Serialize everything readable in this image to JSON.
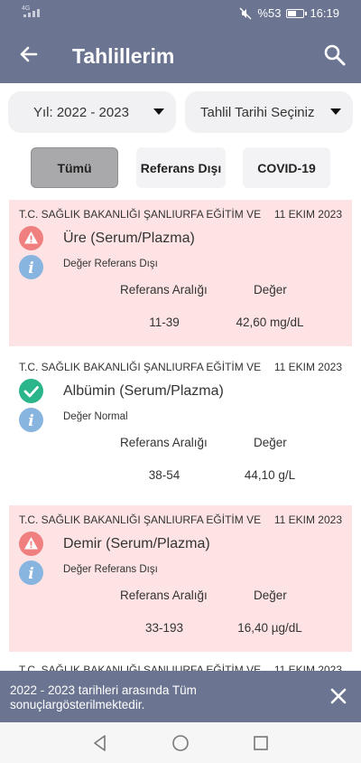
{
  "status_bar": {
    "network": "4G",
    "battery": "%53",
    "time": "16:19"
  },
  "header": {
    "title": "Tahlillerim"
  },
  "dropdowns": {
    "year": "Yıl: 2022 - 2023",
    "date": "Tahlil Tarihi Seçiniz"
  },
  "filters": [
    "Tümü",
    "Referans Dışı",
    "COVID-19"
  ],
  "results": [
    {
      "institution": "T.C. SAĞLIK BAKANLIĞI ŞANLIURFA EĞİTİM VE",
      "date": "11 EKIM 2023",
      "name": "Üre (Serum/Plazma)",
      "note": "Değer Referans Dışı",
      "range_header": "Referans Aralığı",
      "value_header": "Değer",
      "range": "11-39",
      "value": "42,60 mg/dL",
      "status": "out-of-range"
    },
    {
      "institution": "T.C. SAĞLIK BAKANLIĞI ŞANLIURFA EĞİTİM VE",
      "date": "11 EKIM 2023",
      "name": "Albümin (Serum/Plazma)",
      "note": "Değer Normal",
      "range_header": "Referans Aralığı",
      "value_header": "Değer",
      "range": "38-54",
      "value": "44,10 g/L",
      "status": "normal"
    },
    {
      "institution": "T.C. SAĞLIK BAKANLIĞI ŞANLIURFA EĞİTİM VE",
      "date": "11 EKIM 2023",
      "name": "Demir (Serum/Plazma)",
      "note": "Değer Referans Dışı",
      "range_header": "Referans Aralığı",
      "value_header": "Değer",
      "range": "33-193",
      "value": "16,40 µg/dL",
      "status": "out-of-range"
    },
    {
      "institution": "T.C. SAĞLIK BAKANLIĞI ŞANLIURFA EĞİTİM VE",
      "date": "11 EKIM 2023"
    }
  ],
  "snackbar": {
    "message": "2022 - 2023 tarihleri arasında Tüm sonuçlargösterilmektedir."
  },
  "icons": {
    "back": "arrow-left-icon",
    "search": "search-icon",
    "warning": "warning-icon",
    "check": "check-circle-icon",
    "info": "info-icon",
    "close": "close-icon"
  },
  "colors": {
    "appbar": "#6b7591",
    "out_of_range_bg": "#fde3e3",
    "warning": "#f08080",
    "check": "#2bb58b",
    "info": "#88b4e0"
  }
}
